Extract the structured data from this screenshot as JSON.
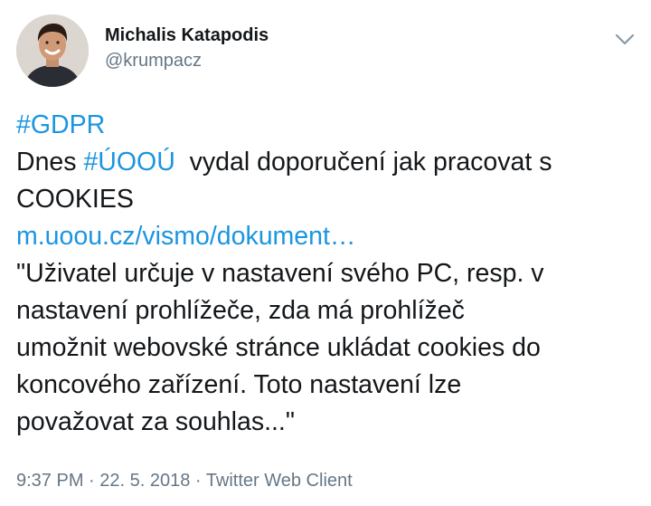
{
  "author": {
    "name": "Michalis Katapodis",
    "handle": "@krumpacz"
  },
  "icons": {
    "avatar": "profile-photo",
    "menu": "chevron-down-icon"
  },
  "tweet": {
    "hashtag_gdpr": "#GDPR",
    "line2_prefix": "Dnes ",
    "hashtag_uoou": "#ÚOOÚ",
    "line2_suffix": "  vydal doporučení jak pracovat s",
    "line3": "COOKIES",
    "link": "m.uoou.cz/vismo/dokument…",
    "quote_lines": [
      "\"Uživatel určuje v nastavení svého PC, resp. v",
      "nastavení prohlížeče, zda má prohlížeč",
      "umožnit webovské stránce ukládat cookies do",
      "koncového zařízení. Toto nastavení lze",
      "považovat za souhlas...\""
    ]
  },
  "meta": {
    "time": "9:37 PM",
    "separator": " · ",
    "date": "22. 5. 2018",
    "client": "Twitter Web Client"
  },
  "colors": {
    "link": "#1b95e0",
    "secondary_text": "#657786",
    "primary_text": "#14171a"
  }
}
